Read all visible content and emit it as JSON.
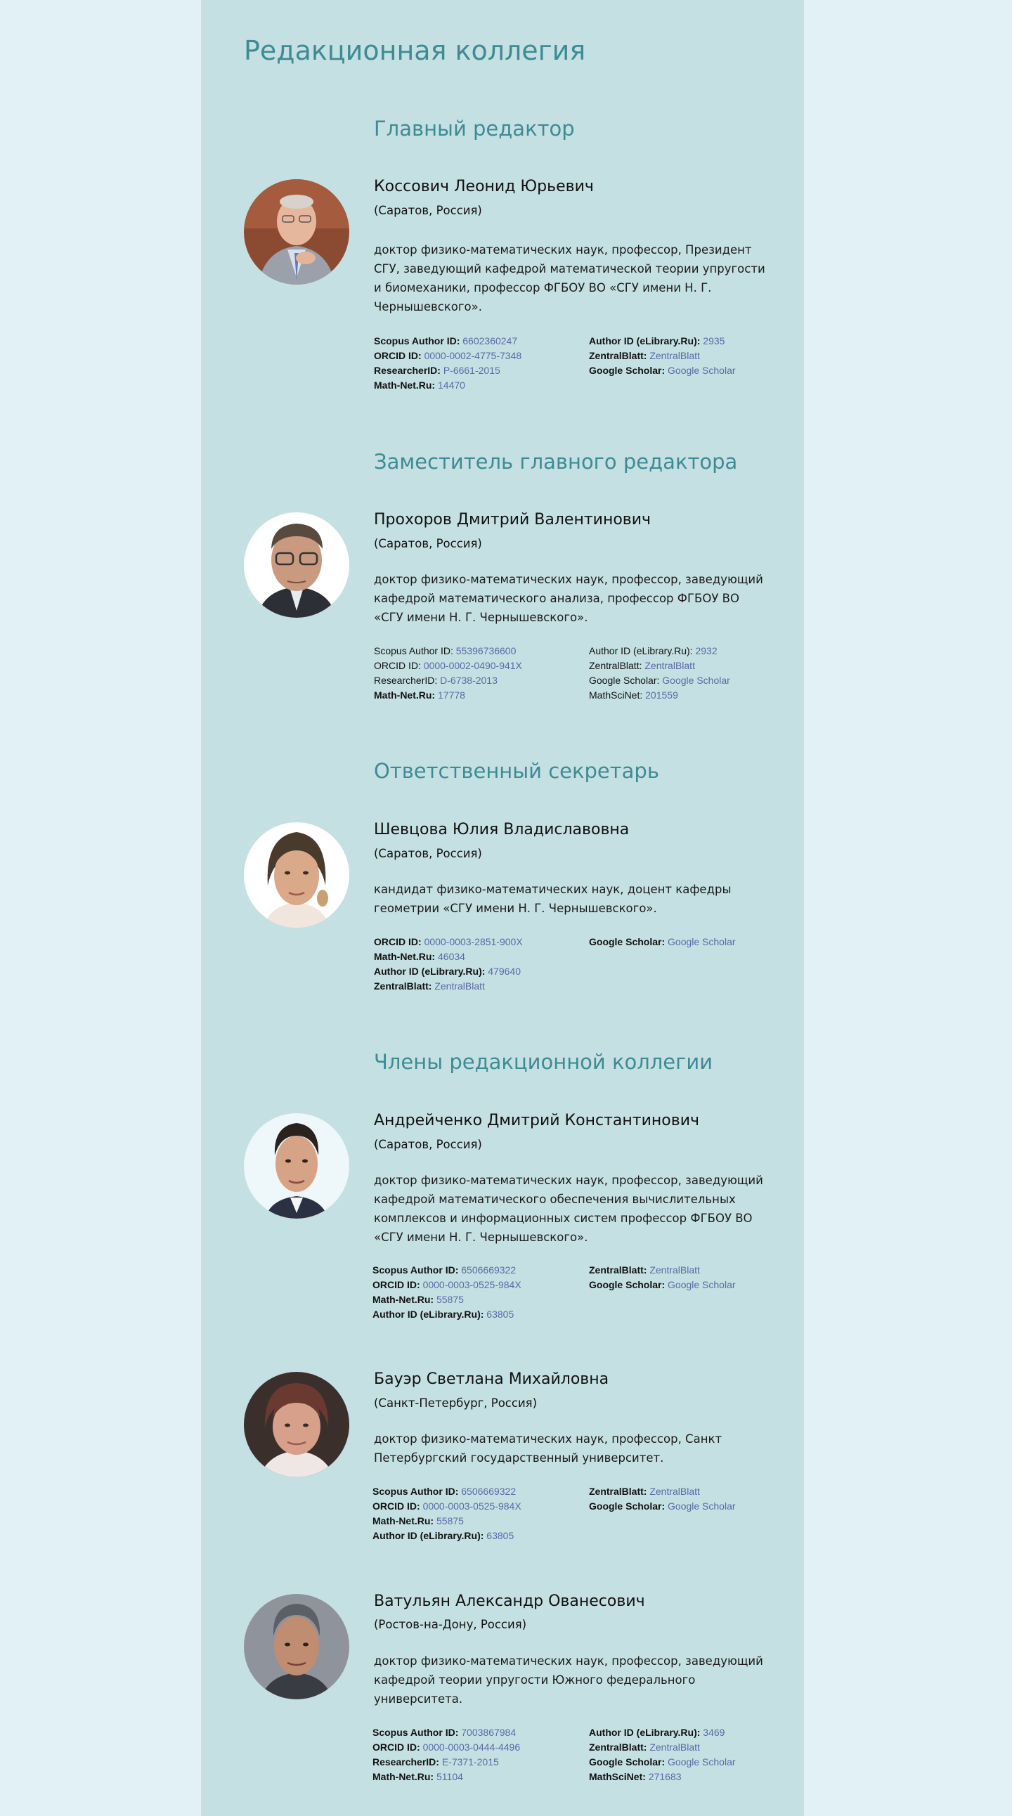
{
  "page_title": "Редакционная коллегия",
  "colors": {
    "page_bg": "#e2f1f5",
    "panel_bg": "#c5e0e3",
    "heading": "#3e8b94",
    "link": "#5b69a6"
  },
  "sections": [
    {
      "title": "Главный редактор",
      "people": [
        {
          "name": "Коссович Леонид Юрьевич",
          "location": "(Саратов, Россия)",
          "description": "доктор физико-математических наук, профессор, Президент СГУ, заведующий кафедрой математической теории упругости и биомеханики, профессор ФГБОУ ВО «СГУ имени Н. Г. Чернышевского».",
          "ids_left": [
            {
              "label": "Scopus Author ID:",
              "value": "6602360247"
            },
            {
              "label": "ORCID ID:",
              "value": "0000-0002-4775-7348"
            },
            {
              "label": "ResearcherID:",
              "value": "P-6661-2015"
            },
            {
              "label": "Math-Net.Ru:",
              "value": "14470"
            }
          ],
          "ids_right": [
            {
              "label": "Author ID (eLibrary.Ru):",
              "value": "2935"
            },
            {
              "label": "ZentralBlatt:",
              "value": "ZentralBlatt"
            },
            {
              "label": "Google Scholar:",
              "value": "Google Scholar"
            }
          ]
        }
      ]
    },
    {
      "title": "Заместитель главного редактора",
      "people": [
        {
          "name": "Прохоров Дмитрий Валентинович",
          "location": "(Саратов, Россия)",
          "description": "доктор физико-математических наук, профессор, заведующий кафедрой математического анализа, профессор ФГБОУ ВО «СГУ имени  Н. Г. Чернышевского».",
          "ids_left": [
            {
              "label": "Scopus Author ID:",
              "value": "55396736600"
            },
            {
              "label": "ORCID ID:",
              "value": "0000-0002-0490-941X"
            },
            {
              "label": "ResearcherID:",
              "value": "D-6738-2013"
            },
            {
              "label": "Math-Net.Ru:",
              "value": "17778"
            }
          ],
          "ids_right": [
            {
              "label": "Author ID (eLibrary.Ru):",
              "value": "2932"
            },
            {
              "label": "ZentralBlatt:",
              "value": "ZentralBlatt"
            },
            {
              "label": "Google Scholar:",
              "value": "Google Scholar"
            },
            {
              "label": "MathSciNet:",
              "value": "201559"
            }
          ]
        }
      ]
    },
    {
      "title": "Ответственный секретарь",
      "people": [
        {
          "name": "Шевцова Юлия Владиславовна",
          "location": "(Саратов, Россия)",
          "description": "кандидат физико-математических наук, доцент кафедры геометрии «СГУ имени Н. Г. Чернышевского».",
          "ids_left": [
            {
              "label": "ORCID ID:",
              "value": "0000-0003-2851-900X"
            },
            {
              "label": "Math-Net.Ru:",
              "value": "46034"
            },
            {
              "label": "Author ID (eLibrary.Ru):",
              "value": "479640"
            },
            {
              "label": "ZentralBlatt:",
              "value": "ZentralBlatt"
            }
          ],
          "ids_right": [
            {
              "label": "Google Scholar:",
              "value": "Google Scholar"
            }
          ]
        }
      ]
    },
    {
      "title": "Члены редакционной коллегии",
      "people": [
        {
          "name": "Андрейченко Дмитрий Константинович",
          "location": "(Саратов, Россия)",
          "description": "доктор физико-математических наук, профессор, заведующий кафедрой математического обеспечения вычислительных комплексов и информационных систем профессор ФГБОУ ВО «СГУ имени Н. Г. Чернышевского».",
          "ids_left": [
            {
              "label": "Scopus Author ID:",
              "value": "6506669322"
            },
            {
              "label": "ORCID ID: ",
              "value": "0000-0003-0525-984X"
            },
            {
              "label": "Math-Net.Ru:",
              "value": "55875"
            },
            {
              "label": "Author ID (eLibrary.Ru):",
              "value": "63805"
            }
          ],
          "ids_right": [
            {
              "label": "ZentralBlatt:",
              "value": "ZentralBlatt"
            },
            {
              "label": "Google Scholar:",
              "value": "Google Scholar"
            }
          ]
        },
        {
          "name": "Бауэр Светлана Михайловна",
          "location": "(Санкт-Петербург, Россия)",
          "description": "доктор физико-математических наук, профессор, Санкт Петербургский государственный университет.",
          "ids_left": [
            {
              "label": "Scopus Author ID:",
              "value": "6506669322"
            },
            {
              "label": "ORCID ID: ",
              "value": "0000-0003-0525-984X"
            },
            {
              "label": "Math-Net.Ru:",
              "value": "55875"
            },
            {
              "label": "Author ID (eLibrary.Ru):",
              "value": "63805"
            }
          ],
          "ids_right": [
            {
              "label": "ZentralBlatt:",
              "value": "ZentralBlatt"
            },
            {
              "label": "Google Scholar:",
              "value": "Google Scholar"
            }
          ]
        },
        {
          "name": "Ватульян Александр Ованесович",
          "location": "(Ростов-на-Дону, Россия)",
          "description": "доктор физико-математических наук, профессор, заведующий кафедрой теории упругости Южного федерального университета.",
          "ids_left": [
            {
              "label": "Scopus Author ID:",
              "value": "7003867984"
            },
            {
              "label": "ORCID ID:",
              "value": "0000-0003-0444-4496"
            },
            {
              "label": "ResearcherID:",
              "value": "E-7371-2015"
            },
            {
              "label": "Math-Net.Ru:",
              "value": "51104"
            }
          ],
          "ids_right": [
            {
              "label": "Author ID (eLibrary.Ru):",
              "value": "3469"
            },
            {
              "label": "ZentralBlatt:",
              "value": "ZentralBlatt"
            },
            {
              "label": "Google Scholar:",
              "value": "Google Scholar"
            },
            {
              "label": "MathSciNet:",
              "value": "271683"
            }
          ]
        }
      ]
    }
  ]
}
